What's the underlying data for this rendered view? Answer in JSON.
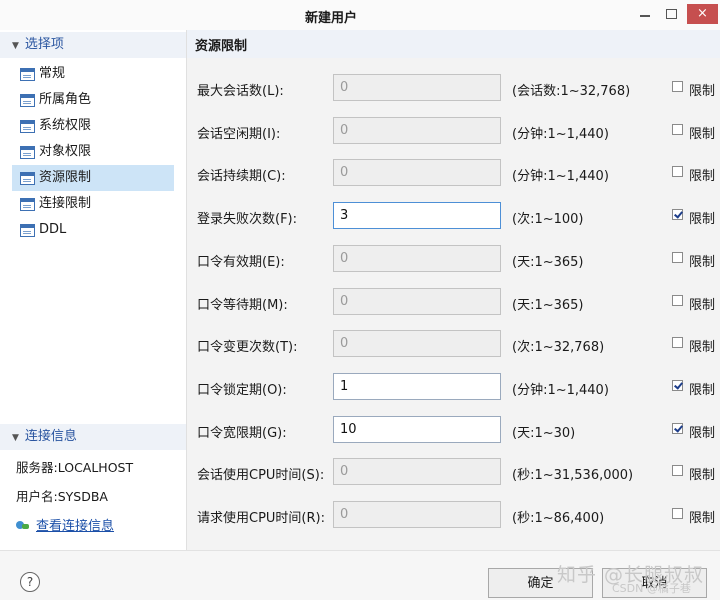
{
  "window": {
    "title": "新建用户",
    "close_glyph": "×"
  },
  "sidebar": {
    "section_header": "选择项",
    "items": [
      {
        "label": "常规"
      },
      {
        "label": "所属角色"
      },
      {
        "label": "系统权限"
      },
      {
        "label": "对象权限"
      },
      {
        "label": "资源限制",
        "selected": true
      },
      {
        "label": "连接限制"
      },
      {
        "label": "DDL"
      }
    ],
    "connection": {
      "header": "连接信息",
      "server": "服务器:LOCALHOST",
      "username": "用户名:SYSDBA",
      "view_link": "查看连接信息"
    }
  },
  "main": {
    "title": "资源限制",
    "check_label": "限制",
    "fields": [
      {
        "label": "最大会话数(L):",
        "value": "0",
        "range": "(会话数:1~32,768)",
        "enabled": false,
        "checked": false
      },
      {
        "label": "会话空闲期(I):",
        "value": "0",
        "range": "(分钟:1~1,440)",
        "enabled": false,
        "checked": false
      },
      {
        "label": "会话持续期(C):",
        "value": "0",
        "range": "(分钟:1~1,440)",
        "enabled": false,
        "checked": false
      },
      {
        "label": "登录失败次数(F):",
        "value": "3",
        "range": "(次:1~100)",
        "enabled": true,
        "checked": true
      },
      {
        "label": "口令有效期(E):",
        "value": "0",
        "range": "(天:1~365)",
        "enabled": false,
        "checked": false
      },
      {
        "label": "口令等待期(M):",
        "value": "0",
        "range": "(天:1~365)",
        "enabled": false,
        "checked": false
      },
      {
        "label": "口令变更次数(T):",
        "value": "0",
        "range": "(次:1~32,768)",
        "enabled": false,
        "checked": false
      },
      {
        "label": "口令锁定期(O):",
        "value": "1",
        "range": "(分钟:1~1,440)",
        "enabled": true,
        "checked": true
      },
      {
        "label": "口令宽限期(G):",
        "value": "10",
        "range": "(天:1~30)",
        "enabled": true,
        "checked": true
      },
      {
        "label": "会话使用CPU时间(S):",
        "value": "0",
        "range": "(秒:1~31,536,000)",
        "enabled": false,
        "checked": false
      },
      {
        "label": "请求使用CPU时间(R):",
        "value": "0",
        "range": "(秒:1~86,400)",
        "enabled": false,
        "checked": false
      }
    ]
  },
  "footer": {
    "help_glyph": "?",
    "ok_label": "确定",
    "cancel_label": "取消",
    "watermark": "知乎 @长腿叔叔",
    "watermark_small": "CSDN @橘子巷"
  },
  "colors": {
    "accent": "#2a55a0",
    "selection": "#cde4f7",
    "check": "#1e3e8a",
    "link": "#1b4fa8",
    "close_button": "#c64f4f"
  }
}
